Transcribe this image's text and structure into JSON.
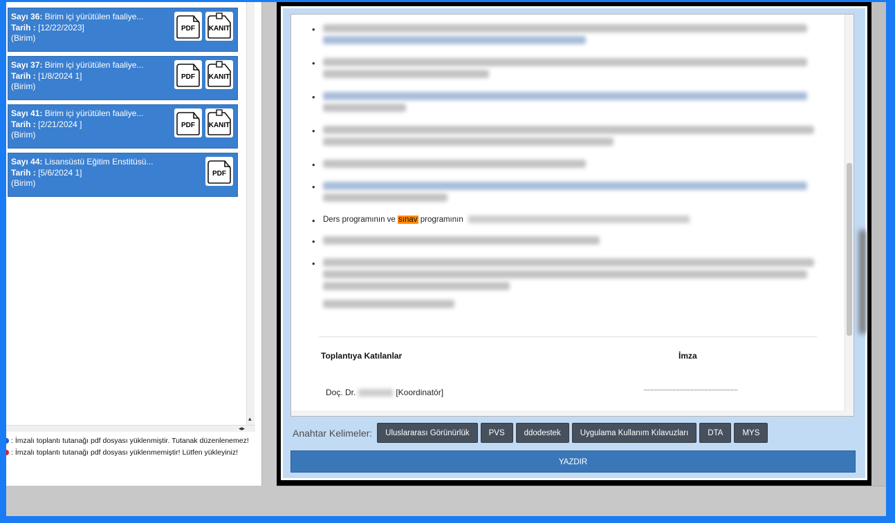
{
  "records": [
    {
      "label": "Sayı 36:",
      "title": "Birim içi yürütülen faaliye...",
      "date_label": "Tarih :",
      "date": "[12/22/2023]",
      "unit": "(Birim)",
      "icons": [
        "PDF",
        "KANIT"
      ]
    },
    {
      "label": "Sayı 37:",
      "title": "Birim içi yürütülen faaliye...",
      "date_label": "Tarih :",
      "date": "[1/8/2024 1]",
      "unit": "(Birim)",
      "icons": [
        "PDF",
        "KANIT"
      ]
    },
    {
      "label": "Sayı 41:",
      "title": "Birim içi yürütülen faaliye...",
      "date_label": "Tarih :",
      "date": "[2/21/2024 ]",
      "unit": "(Birim)",
      "icons": [
        "PDF",
        "KANIT"
      ]
    },
    {
      "label": "Sayı 44:",
      "title": "Lisansüstü Eğitim Enstitüsü...",
      "date_label": "Tarih :",
      "date": "[5/6/2024 1]",
      "unit": "(Birim)",
      "icons": [
        "PDF"
      ]
    }
  ],
  "legend": {
    "uploaded": ": İmzalı toplantı tutanağı pdf dosyası yüklenmiştir. Tutanak düzenlenemez!",
    "not_uploaded": ": İmzalı toplantı tutanağı pdf dosyası yüklenmemiştir! Lütfen yükleyiniz!"
  },
  "document": {
    "visible_bullet_pre": "Ders programının ve",
    "visible_bullet_highlight": "sınav",
    "visible_bullet_post": "programının",
    "participants_header": "Toplantıya Katılanlar",
    "signature_header": "İmza",
    "participant_title": "Doç. Dr.",
    "participant_role": "[Koordinatör]",
    "signature_dots": "...................................................."
  },
  "keywords": {
    "label": "Anahtar Kelimeler:",
    "items": [
      "Uluslararası Görünürlük",
      "PVS",
      "ddodestek",
      "Uygulama Kullanım Kılavuzları",
      "DTA",
      "MYS"
    ]
  },
  "print_button": "YAZDIR",
  "colors": {
    "outer_border": "#1a7cf5",
    "card_bg": "#3a7fd0",
    "highlight": "#ff8c00",
    "keyword_btn": "#47505d",
    "print_btn": "#3a77b8",
    "legend_uploaded": "#1a5fd0",
    "legend_not_uploaded": "#e02020"
  }
}
